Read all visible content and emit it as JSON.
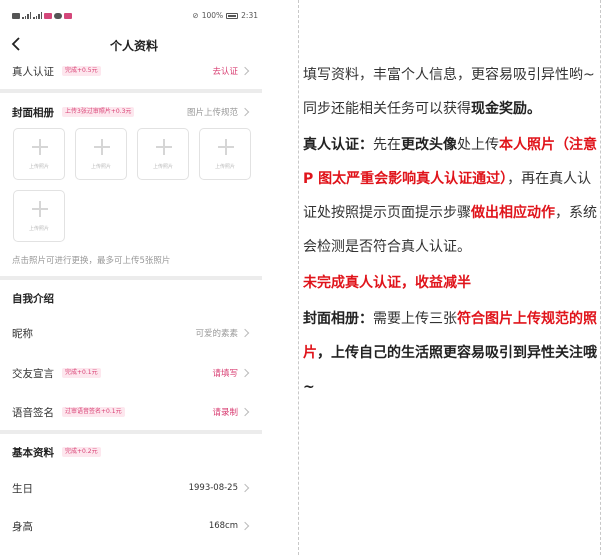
{
  "status_bar": {
    "left_icons": "signal-wifi-notification-icons",
    "battery": "100%",
    "time": "2:31"
  },
  "nav": {
    "title": "个人资料"
  },
  "verify": {
    "label": "真人认证",
    "badge": "完成+0.5元",
    "action": "去认证"
  },
  "album": {
    "label": "封面相册",
    "badge": "上传3张过审照片+0.3元",
    "action": "图片上传规范",
    "slot_text": "上传照片",
    "hint": "点击照片可进行更换，最多可上传5张照片"
  },
  "intro": {
    "section": "自我介绍",
    "nickname": {
      "label": "昵称",
      "value": "可爱的素素"
    },
    "declaration": {
      "label": "交友宣言",
      "badge": "完成+0.1元",
      "action": "请填写"
    },
    "voice": {
      "label": "语音签名",
      "badge": "过审语音签名+0.1元",
      "action": "请录制"
    }
  },
  "basic": {
    "section": "基本资料",
    "badge": "完成+0.2元",
    "birthday": {
      "label": "生日",
      "value": "1993-08-25"
    },
    "height": {
      "label": "身高",
      "value": "168cm"
    }
  },
  "article": {
    "p1": "填写资料，丰富个人信息，更容易吸引异性哟~同步还能相关任务可以获得",
    "p1_bold": "现金奖励。",
    "p2_bold1": "真人认证：",
    "p2_a": "先在",
    "p2_bold2": "更改头像",
    "p2_b": "处上传",
    "p2_red1": "本人照片（注意 P 图太严重会影响真人认证通过）",
    "p2_c": "，再在真人认证处按照提示页面提示步骤",
    "p2_red2": "做出相应动作",
    "p2_d": "，系统会检测是否符合真人认证。",
    "p3_red": "未完成真人认证，收益减半",
    "p4_bold1": "封面相册：",
    "p4_a": "需要上传三张",
    "p4_red": "符合图片上传规范的照片",
    "p4_bold2": "，上传自己的生活照更容易吸引到异性关注哦~"
  },
  "colors": {
    "accent": "#d94074",
    "red": "#e0141b",
    "separator": "#ececec"
  }
}
